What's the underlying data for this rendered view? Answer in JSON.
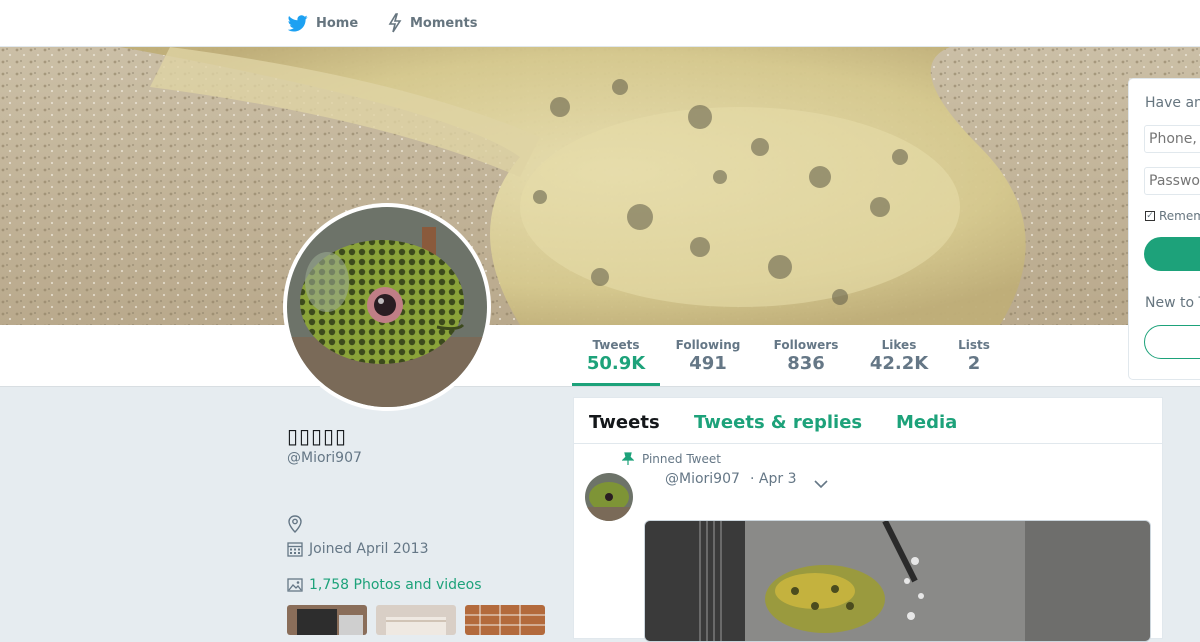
{
  "nav": {
    "home_label": "Home",
    "moments_label": "Moments",
    "brand_color": "#1da1f2"
  },
  "stats": [
    {
      "label": "Tweets",
      "value": "50.9K",
      "active": true
    },
    {
      "label": "Following",
      "value": "491"
    },
    {
      "label": "Followers",
      "value": "836"
    },
    {
      "label": "Likes",
      "value": "42.2K"
    },
    {
      "label": "Lists",
      "value": "2"
    }
  ],
  "profile": {
    "name": "▯▯▯▯▯",
    "handle": "@Miori907",
    "joined": "Joined April 2013",
    "photos_videos": "1,758 Photos and videos"
  },
  "timeline": {
    "tabs": [
      "Tweets",
      "Tweets & replies",
      "Media"
    ],
    "pinned_label": "Pinned Tweet",
    "tweet": {
      "handle": "@Miori907",
      "date": "· Apr 3"
    }
  },
  "login": {
    "title": "Have an",
    "phone_placeholder": "Phone,",
    "password_placeholder": "Passwo",
    "remember": "Remem",
    "new_label": "New to T"
  },
  "colors": {
    "accent": "#1da27a",
    "muted": "#657786",
    "background": "#e6ecf0"
  },
  "icons": [
    "twitter-bird-icon",
    "moments-bolt-icon",
    "location-icon",
    "calendar-icon",
    "image-icon",
    "pin-icon",
    "chevron-down-icon"
  ]
}
